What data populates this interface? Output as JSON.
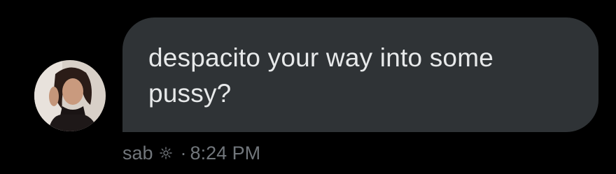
{
  "message": {
    "text": "despacito your way into some pussy?",
    "sender": "sab",
    "separator": "·",
    "time": "8:24 PM"
  },
  "icons": {
    "sender_badge": "sun-icon"
  },
  "colors": {
    "background": "#000000",
    "bubble": "#2f3336",
    "message_text": "#e7e9ea",
    "meta_text": "#71767b"
  }
}
